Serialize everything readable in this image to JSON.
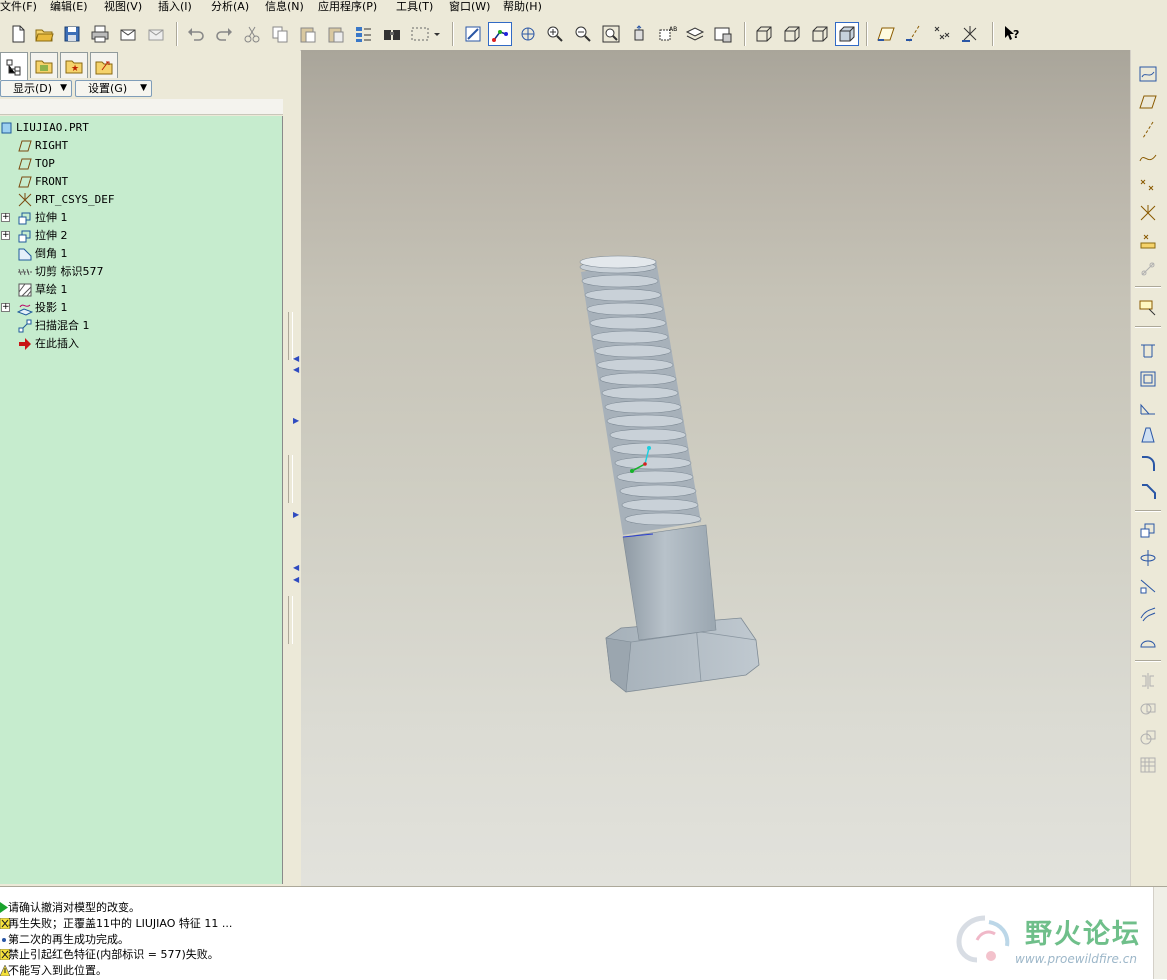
{
  "menu": [
    {
      "label": "文件(F)"
    },
    {
      "label": "编辑(E)"
    },
    {
      "label": "视图(V)"
    },
    {
      "label": "插入(I)"
    },
    {
      "label": "分析(A)"
    },
    {
      "label": "信息(N)"
    },
    {
      "label": "应用程序(P)"
    },
    {
      "label": "工具(T)"
    },
    {
      "label": "窗口(W)"
    },
    {
      "label": "帮助(H)"
    }
  ],
  "toolbar": {
    "icons": [
      "new-file-icon",
      "open-folder-icon",
      "save-icon",
      "print-icon",
      "email-icon",
      "email-link-icon",
      "undo-icon",
      "redo-icon",
      "cut-icon",
      "copy-icon",
      "paste-icon",
      "paste-special-icon",
      "regenerate-icon",
      "find-icon",
      "select-box-icon",
      "repaint-icon",
      "spin-center-icon",
      "orient-mode-icon",
      "zoom-in-icon",
      "zoom-out-icon",
      "refit-icon",
      "reorient-icon",
      "saved-views-icon",
      "layers-icon",
      "view-manager-icon",
      "wireframe-icon",
      "hidden-line-icon",
      "no-hidden-icon",
      "shading-icon",
      "datum-planes-icon",
      "datum-axes-icon",
      "datum-points-icon",
      "coordinate-systems-icon",
      "context-help-icon"
    ]
  },
  "navigator": {
    "display_label": "显示(D)",
    "settings_label": "设置(G)"
  },
  "model_tree": {
    "items": [
      {
        "label": "LIUJIAO.PRT",
        "icon": "part-icon",
        "expandable": false
      },
      {
        "label": "RIGHT",
        "icon": "datum-plane-icon",
        "expandable": false
      },
      {
        "label": "TOP",
        "icon": "datum-plane-icon",
        "expandable": false
      },
      {
        "label": "FRONT",
        "icon": "datum-plane-icon",
        "expandable": false
      },
      {
        "label": "PRT_CSYS_DEF",
        "icon": "csys-icon",
        "expandable": false
      },
      {
        "label": "拉伸 1",
        "icon": "extrude-icon",
        "expandable": true
      },
      {
        "label": "拉伸 2",
        "icon": "extrude-icon",
        "expandable": true
      },
      {
        "label": "倒角 1",
        "icon": "chamfer-icon",
        "expandable": false
      },
      {
        "label": "切剪 标识577",
        "icon": "cut-icon",
        "expandable": false
      },
      {
        "label": "草绘 1",
        "icon": "sketch-icon",
        "expandable": false
      },
      {
        "label": "投影 1",
        "icon": "projection-icon",
        "expandable": true
      },
      {
        "label": "扫描混合 1",
        "icon": "swept-blend-icon",
        "expandable": false
      },
      {
        "label": "在此插入",
        "icon": "insert-here-icon",
        "expandable": false
      }
    ]
  },
  "messages": [
    {
      "icon": "prompt-icon",
      "text": "请确认撤消对模型的改变。"
    },
    {
      "icon": "warning-icon",
      "text": "再生失败；正覆盖11中的 LIUJIAO 特征 11 ..."
    },
    {
      "icon": "info-icon",
      "text": "第二次的再生成功完成。"
    },
    {
      "icon": "warning-icon",
      "text": "禁止引起红色特征(内部标识 = 577)失败。"
    },
    {
      "icon": "error-icon",
      "text": "不能写入到此位置。"
    }
  ],
  "watermark": {
    "text": "野火论坛",
    "url": "www.proewildfire.cn"
  },
  "colors": {
    "tree_background": "#c6ecce",
    "chrome": "#ece9d8",
    "bolt": "#a9b4bd"
  }
}
